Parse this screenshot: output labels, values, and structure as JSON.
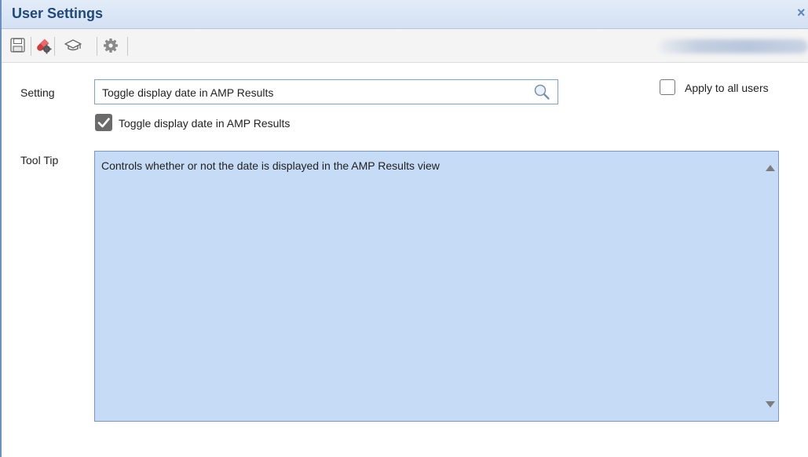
{
  "window": {
    "title": "User Settings",
    "close_glyph": "×"
  },
  "toolbar": {
    "icons": [
      "save-icon",
      "pill-gear-icon",
      "graduation-cap-icon",
      "gear-icon"
    ]
  },
  "form": {
    "setting_label": "Setting",
    "setting_value": "Toggle display date in AMP Results",
    "apply_all_label": "Apply to all users",
    "apply_all_checked": false,
    "toggle_label": "Toggle display date in AMP Results",
    "toggle_checked": true,
    "tooltip_label": "Tool Tip",
    "tooltip_text": "Controls whether or not the date is displayed in the AMP Results view"
  },
  "colors": {
    "title": "#1f497d",
    "tooltip_bg": "#c6dbf6",
    "input_border": "#7fa2cf"
  }
}
